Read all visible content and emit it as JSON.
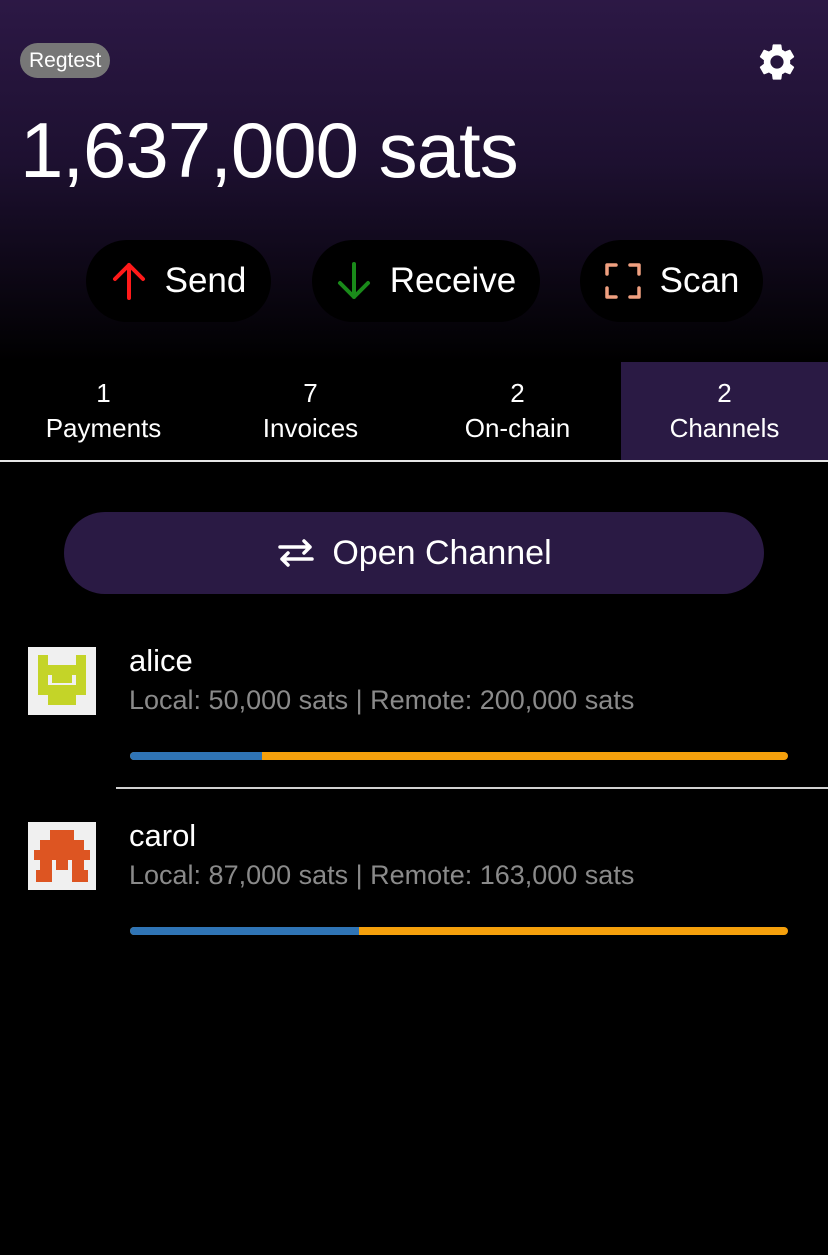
{
  "header": {
    "network_badge": "Regtest",
    "balance": "1,637,000 sats",
    "settings_icon": "gear-icon"
  },
  "actions": {
    "send": "Send",
    "receive": "Receive",
    "scan": "Scan",
    "send_icon_color": "#ff1a1a",
    "receive_icon_color": "#1a8a1a",
    "scan_icon_color": "#f0a080"
  },
  "tabs": [
    {
      "count": "1",
      "label": "Payments",
      "active": false
    },
    {
      "count": "7",
      "label": "Invoices",
      "active": false
    },
    {
      "count": "2",
      "label": "On-chain",
      "active": false
    },
    {
      "count": "2",
      "label": "Channels",
      "active": true
    }
  ],
  "open_channel": {
    "label": "Open Channel",
    "icon": "swap-arrows-icon"
  },
  "channels": [
    {
      "name": "alice",
      "detail": "Local: 50,000 sats | Remote: 200,000 sats",
      "local_fraction": 0.2,
      "avatar_color": "#c4d428"
    },
    {
      "name": "carol",
      "detail": "Local: 87,000 sats | Remote: 163,000 sats",
      "local_fraction": 0.348,
      "avatar_color": "#dd5522"
    }
  ],
  "colors": {
    "accent_purple": "#2a1a44",
    "local_bar": "#2f74b5",
    "remote_bar": "#f5a00c"
  }
}
